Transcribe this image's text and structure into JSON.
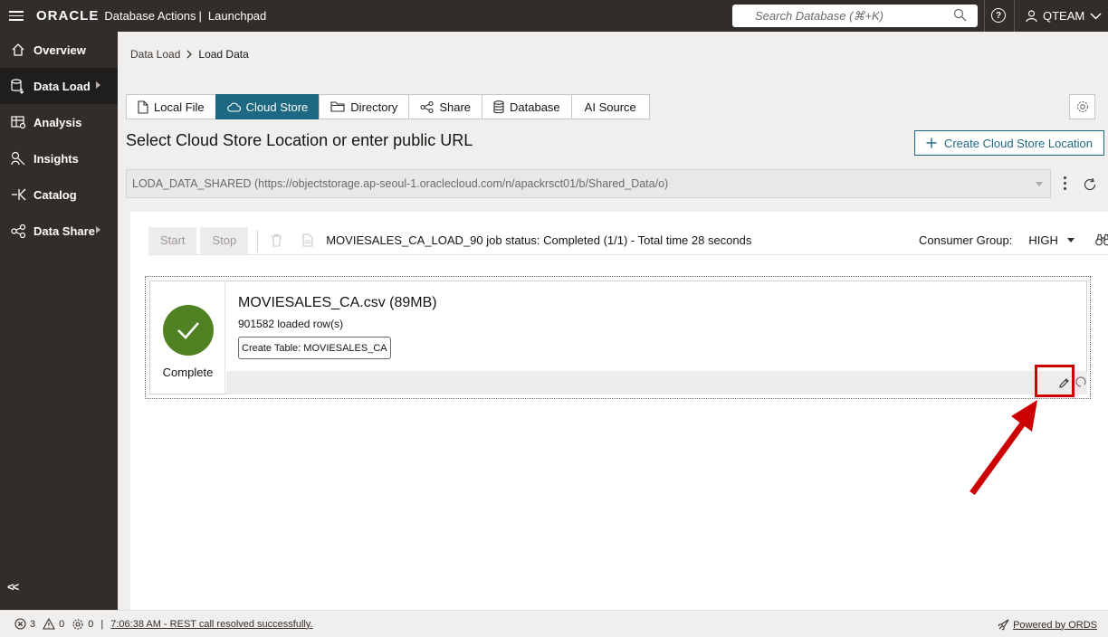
{
  "topbar": {
    "brand": "ORACLE",
    "app_title": "Database Actions",
    "separator": "|",
    "page": "Launchpad",
    "search_placeholder": "Search Database (⌘+K)",
    "help_label": "?",
    "user": "QTEAM"
  },
  "sidebar": {
    "items": [
      {
        "label": "Overview",
        "icon": "home-icon"
      },
      {
        "label": "Data Load",
        "icon": "data-load-icon"
      },
      {
        "label": "Analysis",
        "icon": "analysis-icon"
      },
      {
        "label": "Insights",
        "icon": "insights-icon"
      },
      {
        "label": "Catalog",
        "icon": "catalog-icon"
      },
      {
        "label": "Data Share",
        "icon": "share-icon"
      }
    ],
    "collapse_label": "<<"
  },
  "breadcrumb": {
    "parent": "Data Load",
    "current": "Load Data"
  },
  "tabs": [
    {
      "label": "Local File",
      "icon": "file-icon",
      "active": false
    },
    {
      "label": "Cloud Store",
      "icon": "cloud-icon",
      "active": true
    },
    {
      "label": "Directory",
      "icon": "folder-icon",
      "active": false
    },
    {
      "label": "Share",
      "icon": "share-icon",
      "active": false
    },
    {
      "label": "Database",
      "icon": "database-icon",
      "active": false
    },
    {
      "label": "AI Source",
      "icon": "",
      "active": false
    }
  ],
  "section_title": "Select Cloud Store Location or enter public URL",
  "create_location_label": "Create Cloud Store Location",
  "location_value": "LODA_DATA_SHARED (https://objectstorage.ap-seoul-1.oraclecloud.com/n/apackrsct01/b/Shared_Data/o)",
  "toolbar": {
    "start_label": "Start",
    "stop_label": "Stop",
    "job_status": "MOVIESALES_CA_LOAD_90 job status: Completed (1/1) - Total time 28 seconds",
    "consumer_group_label": "Consumer Group:",
    "consumer_group_value": "HIGH"
  },
  "job_card": {
    "status": "Complete",
    "file_name": "MOVIESALES_CA.csv (89MB)",
    "rows_loaded": "901582 loaded row(s)",
    "table_tag": "Create Table: MOVIESALES_CA"
  },
  "footer": {
    "errors": "3",
    "warnings": "0",
    "settings_count": "0",
    "separator": "|",
    "message": "7:06:38 AM - REST call resolved successfully.",
    "powered_by": "Powered by ORDS"
  },
  "colors": {
    "topbar_bg": "#312d2a",
    "accent": "#1d6882",
    "success": "#508223",
    "annotation": "#cc0000"
  }
}
